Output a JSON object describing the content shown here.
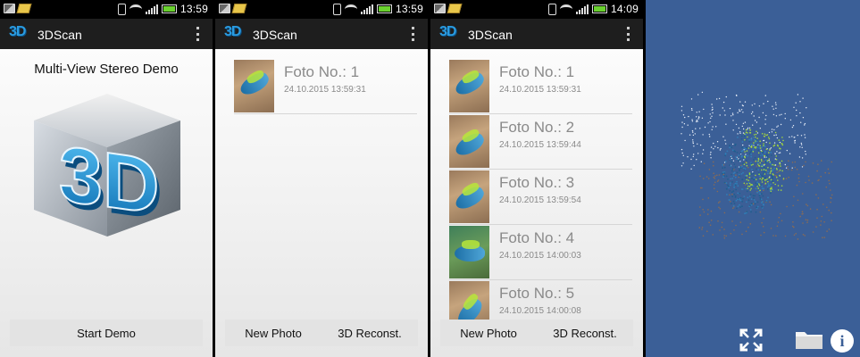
{
  "screens": [
    {
      "status": {
        "time": "13:59"
      },
      "app_title": "3DScan"
    },
    {
      "status": {
        "time": "13:59"
      },
      "app_title": "3DScan"
    },
    {
      "status": {
        "time": "14:09"
      },
      "app_title": "3DScan"
    }
  ],
  "logo_text": "3D",
  "demo": {
    "title": "Multi-View Stereo Demo",
    "cube_text": "3D",
    "start_label": "Start Demo"
  },
  "photos": [
    {
      "title": "Foto No.: 1",
      "date": "24.10.2015 13:59:31"
    },
    {
      "title": "Foto No.: 2",
      "date": "24.10.2015 13:59:44"
    },
    {
      "title": "Foto No.: 3",
      "date": "24.10.2015 13:59:54"
    },
    {
      "title": "Foto No.: 4",
      "date": "24.10.2015 14:00:03"
    },
    {
      "title": "Foto No.: 5",
      "date": "24.10.2015 14:00:08"
    }
  ],
  "toolbar": {
    "new_photo_label": "New Photo",
    "reconstruct_label": "3D Reconst."
  },
  "viewer": {
    "background_color": "#3b5f97",
    "icons": [
      "fullscreen-icon",
      "folder-icon",
      "info-icon"
    ],
    "info_glyph": "i"
  }
}
